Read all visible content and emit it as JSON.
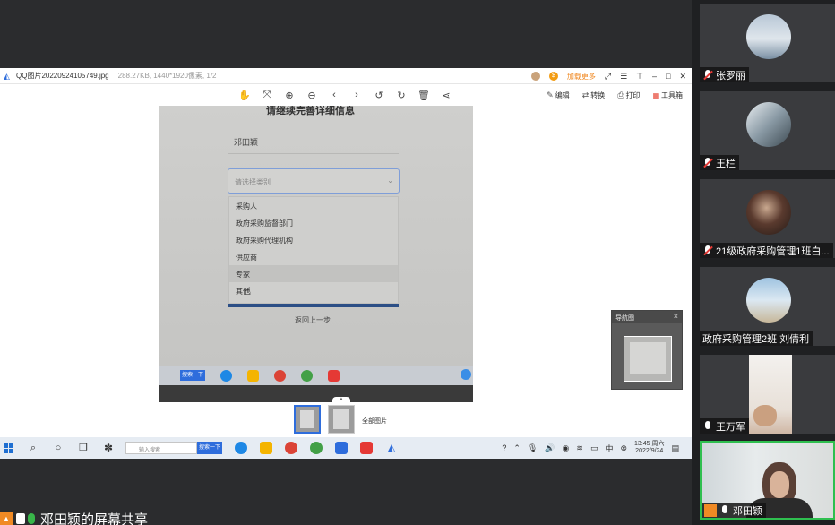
{
  "viewer": {
    "title": "QQ图片20220924105749.jpg",
    "file_info": "288.27KB, 1440*1920像素, 1/2",
    "badge_label": "加载更多",
    "toolbar_right": {
      "edit": "编辑",
      "convert": "转换",
      "print": "打印",
      "toolbox": "工具箱"
    }
  },
  "photo": {
    "form_heading": "请继续完善详细信息",
    "name_value": "邓田颖",
    "select_placeholder": "请选择类别",
    "options": [
      "采购人",
      "政府采购监督部门",
      "政府采购代理机构",
      "供应商",
      "专家",
      "其他"
    ],
    "back_link": "返回上一步",
    "taskbar_search": "搜索一下"
  },
  "thumb_bar": {
    "all_images": "全部图片"
  },
  "minimap": {
    "title": "导航图"
  },
  "win_taskbar": {
    "search_text": "输入搜索",
    "search_button": "搜索一下",
    "time": "13:45 周六",
    "date": "2022/9/24",
    "ime": "中"
  },
  "share_title": "邓田颖的屏幕共享",
  "participants": [
    {
      "name": "张罗丽",
      "muted": true
    },
    {
      "name": "王栏",
      "muted": true
    },
    {
      "name": "21级政府采购管理1班白...",
      "muted": true
    },
    {
      "name": "政府采购管理2班 刘倩利",
      "muted": false
    },
    {
      "name": "王万军",
      "muted": false
    },
    {
      "name": "邓田颖",
      "muted": false
    }
  ],
  "colors": {
    "accent": "#2e6ddc",
    "speaking": "#2fbf4f",
    "host": "#f08a24",
    "muted": "#e53935"
  }
}
